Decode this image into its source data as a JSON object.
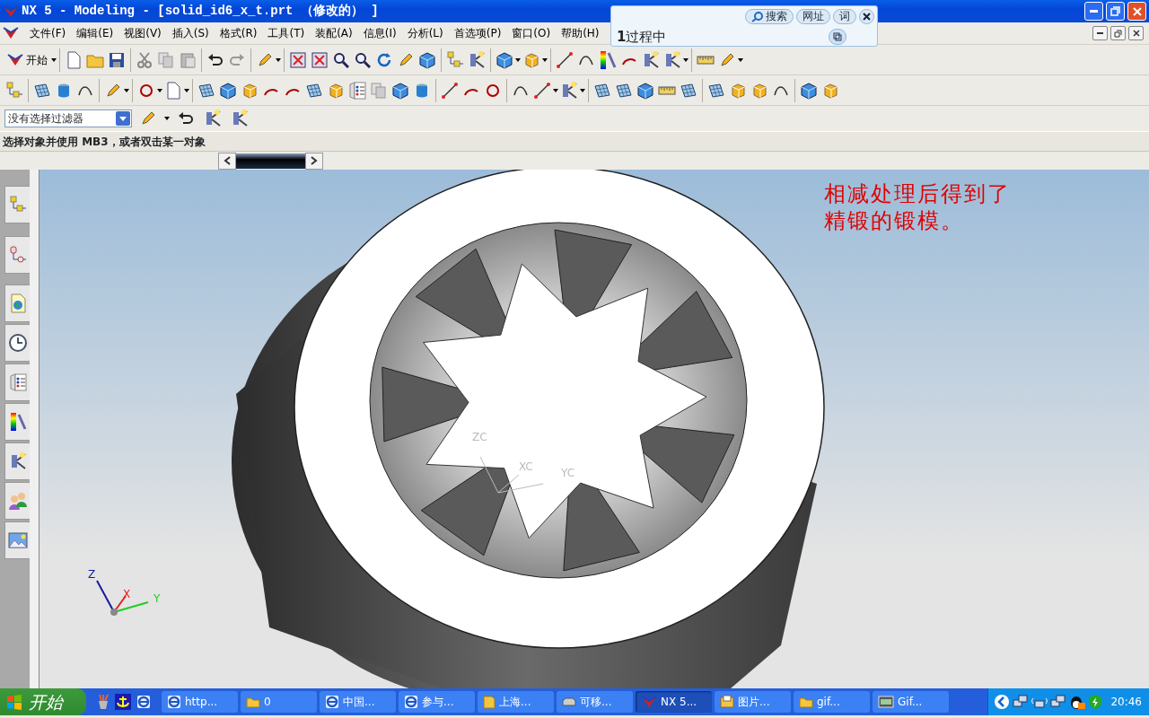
{
  "window": {
    "title": "NX 5 - Modeling - [solid_id6_x_t.prt （修改的） ]"
  },
  "popup": {
    "buttons": [
      {
        "label": "搜索"
      },
      {
        "label": "网址"
      },
      {
        "label": "词"
      }
    ],
    "text": "**1**过程中"
  },
  "menu": [
    "文件(F)",
    "编辑(E)",
    "视图(V)",
    "插入(S)",
    "格式(R)",
    "工具(T)",
    "装配(A)",
    "信息(I)",
    "分析(L)",
    "首选项(P)",
    "窗口(O)",
    "帮助(H)"
  ],
  "toolbar": {
    "start_label": "开始"
  },
  "filter": {
    "value": "没有选择过滤器"
  },
  "status_text": "选择对象并使用 MB3，或者双击某一对象",
  "viewport": {
    "annotation_lines": [
      "相减处理后得到了",
      "精锻的锻模。"
    ],
    "wcs_labels": [
      "ZC",
      "XC",
      "YC"
    ],
    "triad_labels": [
      "Z",
      "X",
      "Y"
    ]
  },
  "taskbar": {
    "start_label": "开始",
    "clock": "20:46",
    "tasks": [
      {
        "kind": "browser",
        "label": "http...",
        "selected": false
      },
      {
        "kind": "folder",
        "label": "0",
        "selected": false
      },
      {
        "kind": "browser",
        "label": "中国...",
        "selected": false
      },
      {
        "kind": "browser",
        "label": "参与...",
        "selected": false
      },
      {
        "kind": "note",
        "label": "上海...",
        "selected": false
      },
      {
        "kind": "drive",
        "label": "可移...",
        "selected": false
      },
      {
        "kind": "nx",
        "label": "NX 5...",
        "selected": true
      },
      {
        "kind": "picture",
        "label": "图片...",
        "selected": false
      },
      {
        "kind": "folder",
        "label": "gif...",
        "selected": false
      },
      {
        "kind": "gif",
        "label": "Gif...",
        "selected": false
      }
    ]
  }
}
